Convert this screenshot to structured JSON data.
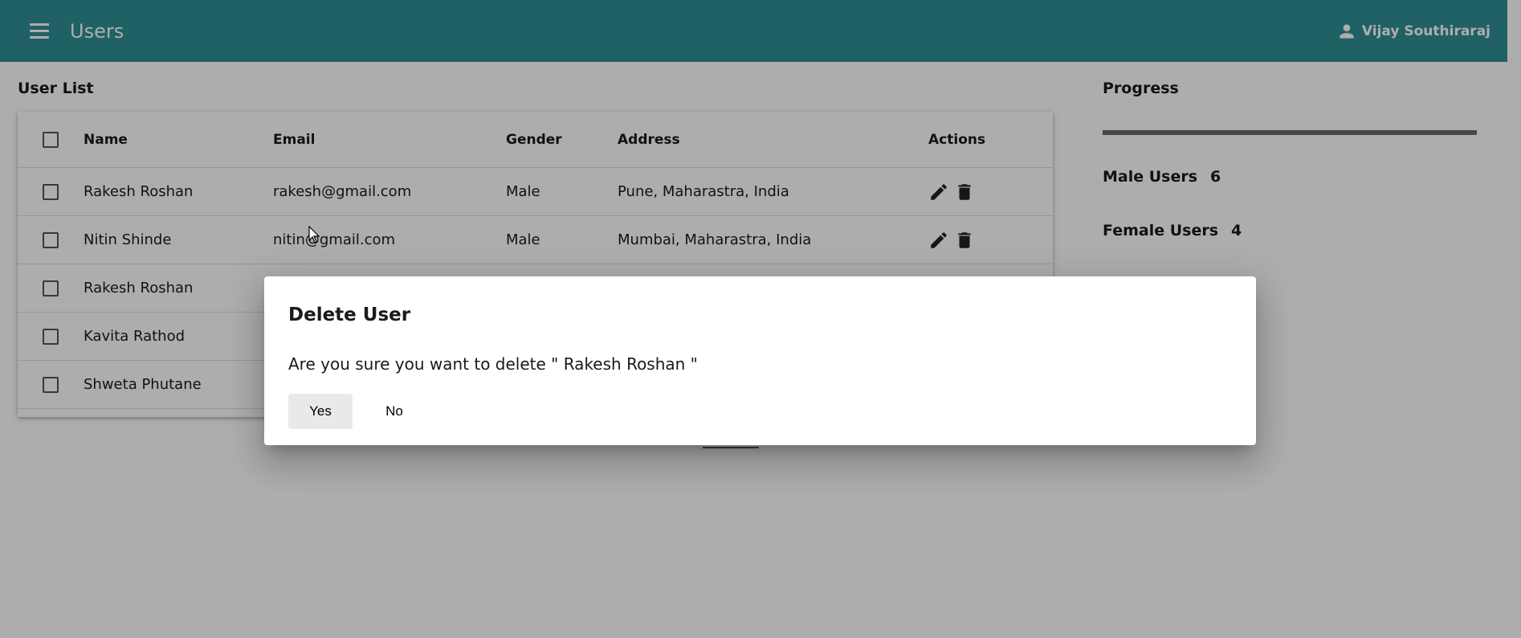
{
  "header": {
    "title": "Users",
    "user_name": "Vijay Southiraraj"
  },
  "user_list": {
    "title": "User List",
    "columns": [
      "Name",
      "Email",
      "Gender",
      "Address",
      "Actions"
    ],
    "rows": [
      {
        "name": "Rakesh Roshan",
        "email": "rakesh@gmail.com",
        "gender": "Male",
        "address": "Pune, Maharastra, India"
      },
      {
        "name": "Nitin Shinde",
        "email": "nitin@gmail.com",
        "gender": "Male",
        "address": "Mumbai, Maharastra, India"
      },
      {
        "name": "Rakesh Roshan",
        "email": "",
        "gender": "",
        "address": ""
      },
      {
        "name": "Kavita Rathod",
        "email": "",
        "gender": "",
        "address": ""
      },
      {
        "name": "Shweta Phutane",
        "email": "",
        "gender": "",
        "address": ""
      }
    ]
  },
  "progress": {
    "title": "Progress",
    "fill_fraction": 1.0,
    "male_label": "Male Users",
    "male_count": "6",
    "female_label": "Female Users",
    "female_count": "4"
  },
  "dialog": {
    "title": "Delete User",
    "message": "Are you sure you want to delete \" Rakesh Roshan \"",
    "yes_label": "Yes",
    "no_label": "No"
  },
  "colors": {
    "toolbar": "#2e8f96",
    "backdrop": "rgba(0,0,0,0.32)"
  }
}
